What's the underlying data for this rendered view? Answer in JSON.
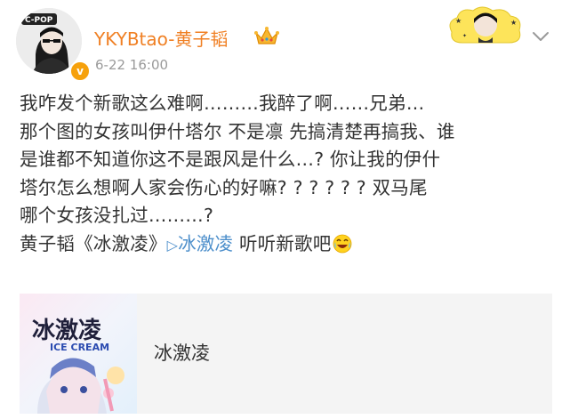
{
  "post": {
    "username": "YKYBtao-黄子韬",
    "timestamp": "6-22 16:00",
    "avatar_text": "C-POP",
    "verified_glyph": "v",
    "icons": [
      "crown-icon",
      "verified-icon",
      "sticker-icon",
      "chevron-down-icon",
      "laughing-emoji-icon",
      "play-icon"
    ],
    "body": {
      "line1": "我咋发个新歌这么难啊………我醉了啊……兄弟…",
      "line2": "那个图的女孩叫伊什塔尔 不是凛 先搞清楚再搞我、谁",
      "line3": "是谁都不知道你这不是跟风是什么…? 你让我的伊什",
      "line4": "塔尔怎么想啊人家会伤心的好嘛? ? ? ? ? ?  双马尾",
      "line5": "哪个女孩没扎过………?",
      "line6_prefix": "黄子韬《冰激凌》",
      "play_symbol": "▷",
      "link_text": "冰激凌",
      "line6_suffix": " 听听新歌吧"
    }
  },
  "card": {
    "title": "冰激凌",
    "cover_title": "冰激凌",
    "cover_subtitle": "ICE CREAM"
  },
  "colors": {
    "username": "#f08024",
    "link": "#4d8fcb",
    "timestamp": "#9a9a9a",
    "card_bg": "#f4f4f4"
  }
}
